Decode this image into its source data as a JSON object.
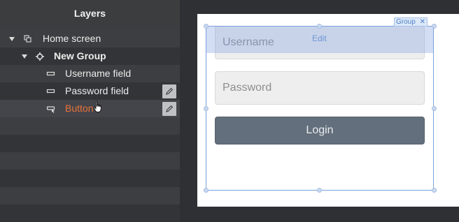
{
  "layers_panel": {
    "title": "Layers",
    "items": [
      {
        "label": "Home screen",
        "icon": "screen-icon"
      },
      {
        "label": "New Group",
        "icon": "group-icon"
      },
      {
        "label": "Username field",
        "icon": "input-icon"
      },
      {
        "label": "Password field",
        "icon": "input-icon"
      },
      {
        "label": "Button",
        "icon": "button-icon"
      }
    ]
  },
  "canvas": {
    "username_placeholder": "Username",
    "password_placeholder": "Password",
    "login_label": "Login",
    "group_tag_label": "Group",
    "group_tag_close": "✕",
    "edit_label": "Edit"
  },
  "colors": {
    "accent_selection": "#7aa1dd",
    "selected_layer": "#e8723a",
    "login_button": "#636f7c"
  }
}
